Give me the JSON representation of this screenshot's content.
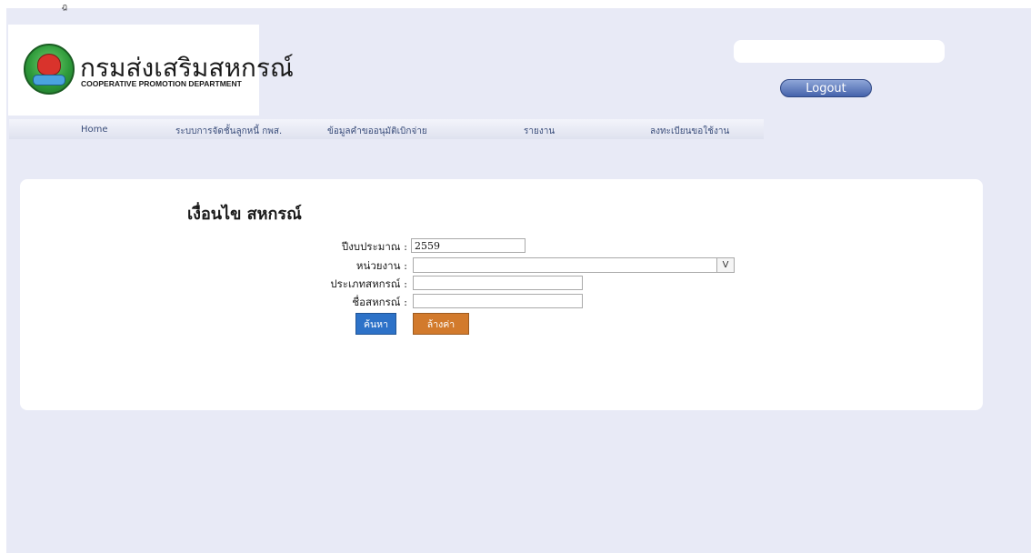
{
  "header": {
    "top_mark": "ฎ",
    "logo": {
      "title_th": "กรมส่งเสริมสหกรณ์",
      "title_en": "COOPERATIVE PROMOTION DEPARTMENT"
    },
    "logout_label": "Logout"
  },
  "nav": {
    "items": [
      {
        "label": "Home"
      },
      {
        "label": "ระบบการจัดชั้นลูกหนี้ กพส."
      },
      {
        "label": "ข้อมูลคำขออนุมัติเบิกจ่าย"
      },
      {
        "label": "รายงาน"
      },
      {
        "label": "ลงทะเบียนขอใช้งาน"
      }
    ]
  },
  "form": {
    "title": "เงื่อนไข สหกรณ์",
    "fiscal_year": {
      "label": "ปีงบประมาณ :",
      "value": "2559"
    },
    "agency": {
      "label": "หน่วยงาน :",
      "value": "",
      "dropdown_glyph": "V"
    },
    "coop_type": {
      "label": "ประเภทสหกรณ์ :",
      "value": ""
    },
    "coop_name": {
      "label": "ชื่อสหกรณ์ :",
      "value": ""
    },
    "search_label": "ค้นหา",
    "clear_label": "ล้างค่า"
  },
  "colors": {
    "page_bg": "#e8eaf6",
    "search_button": "#2d72c8",
    "clear_button": "#d27a2c",
    "logout_button": "#4563ab"
  }
}
